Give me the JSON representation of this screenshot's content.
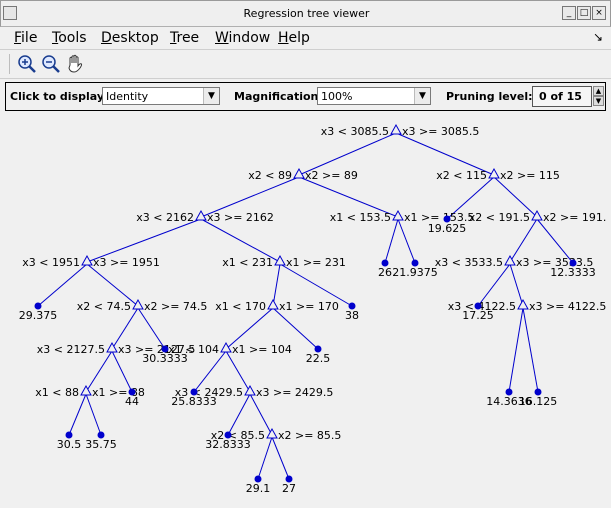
{
  "window": {
    "title": "Regression tree viewer"
  },
  "menu": [
    {
      "label": "File",
      "mnemonic": "F",
      "rest": "ile"
    },
    {
      "label": "Tools",
      "mnemonic": "T",
      "rest": "ools"
    },
    {
      "label": "Desktop",
      "mnemonic": "D",
      "rest": "esktop"
    },
    {
      "label": "Tree",
      "mnemonic": "T",
      "rest": "ree"
    },
    {
      "label": "Window",
      "mnemonic": "W",
      "rest": "indow"
    },
    {
      "label": "Help",
      "mnemonic": "H",
      "rest": "elp"
    }
  ],
  "toolbar": {
    "icons": [
      "zoom-in-icon",
      "zoom-out-icon",
      "pan-hand-icon"
    ]
  },
  "controls": {
    "display_label": "Click to display:",
    "display_value": "Identity",
    "magnification_label": "Magnification:",
    "magnification_value": "100%",
    "pruning_label": "Pruning level:",
    "pruning_value": "0 of 15"
  },
  "colors": {
    "edge": "#0000cc",
    "node": "#0000cc"
  },
  "tree": {
    "splits": [
      {
        "left": "x3 < 3085.5",
        "right": "x3 >= 3085.5"
      },
      {
        "left": "x2 < 89",
        "right": "x2 >= 89"
      },
      {
        "left": "x2 < 115",
        "right": "x2 >= 115"
      },
      {
        "left": "x3 < 2162",
        "right": "x3 >= 2162"
      },
      {
        "left": "x1 < 153.5",
        "right": "x1 >= 153.5"
      },
      {
        "left": "x2 < 191.5",
        "right": "x2 >= 191."
      },
      {
        "left": "x3 < 1951",
        "right": "x3 >= 1951"
      },
      {
        "left": "x1 < 231",
        "right": "x1 >= 231"
      },
      {
        "left": "x3 < 3533.5",
        "right": "x3 >= 3533.5"
      },
      {
        "left": "x2 < 74.5",
        "right": "x2 >= 74.5"
      },
      {
        "left": "x1 < 170",
        "right": "x1 >= 170"
      },
      {
        "left": "x3 < 4122.5",
        "right": "x3 >= 4122.5"
      },
      {
        "left": "x3 < 2127.5",
        "right": "x3 >= 2127.5"
      },
      {
        "left": "x1 < 104",
        "right": "x1 >= 104"
      },
      {
        "left": "x1 < 88",
        "right": "x1 >= 88"
      },
      {
        "left": "x3 < 2429.5",
        "right": "x3 >= 2429.5"
      },
      {
        "left": "x2 < 85.5",
        "right": "x2 >= 85.5"
      }
    ],
    "leaves": [
      "19.625",
      "26",
      "21.9375",
      "12.3333",
      "29.375",
      "38",
      "17.25",
      "30.3333",
      "22.5",
      "14.3636",
      "16.125",
      "44",
      "25.8333",
      "30.5",
      "35.75",
      "32.8333",
      "29.1",
      "27"
    ]
  }
}
